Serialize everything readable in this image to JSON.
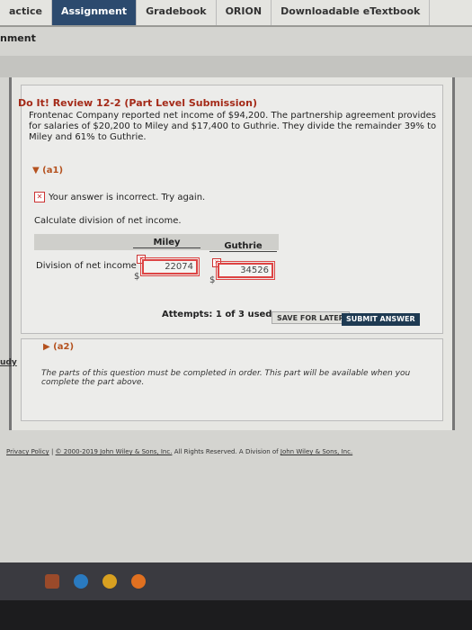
{
  "tabs": [
    {
      "label": "actice"
    },
    {
      "label": "Assignment",
      "active": true
    },
    {
      "label": "Gradebook"
    },
    {
      "label": "ORION"
    },
    {
      "label": "Downloadable eTextbook"
    }
  ],
  "breadcrumb": "nment",
  "question": {
    "title": "Do It! Review 12-2 (Part Level Submission)",
    "text": "Frontenac Company reported net income of $94,200. The partnership agreement provides for salaries of $20,200 to Miley and $17,400 to Guthrie. They divide the remainder 39% to Miley and 61% to Guthrie."
  },
  "a1": {
    "label": "(a1)",
    "feedback": "Your answer is incorrect.  Try again.",
    "instruction": "Calculate division of net income.",
    "columns": [
      "Miley",
      "Guthrie"
    ],
    "row_label": "Division of net income",
    "currency": "$",
    "values": [
      "22074",
      "34526"
    ],
    "attempts": "Attempts: 1 of 3 used",
    "save_label": "SAVE FOR LATER",
    "submit_label": "SUBMIT ANSWER"
  },
  "a2": {
    "label": "(a2)",
    "note": "The parts of this question must be completed in order. This part will be available when you complete the part above."
  },
  "side_link": "udy",
  "footer": {
    "privacy": "Privacy Policy",
    "sep": "|",
    "copyright": "© 2000-2019 John Wiley & Sons, Inc.",
    "rights": "All Rights Reserved. A Division of",
    "company": "John Wiley & Sons, Inc."
  },
  "colors": {
    "accent": "#2c4a6e",
    "error": "#d44",
    "title": "#a42a18"
  }
}
